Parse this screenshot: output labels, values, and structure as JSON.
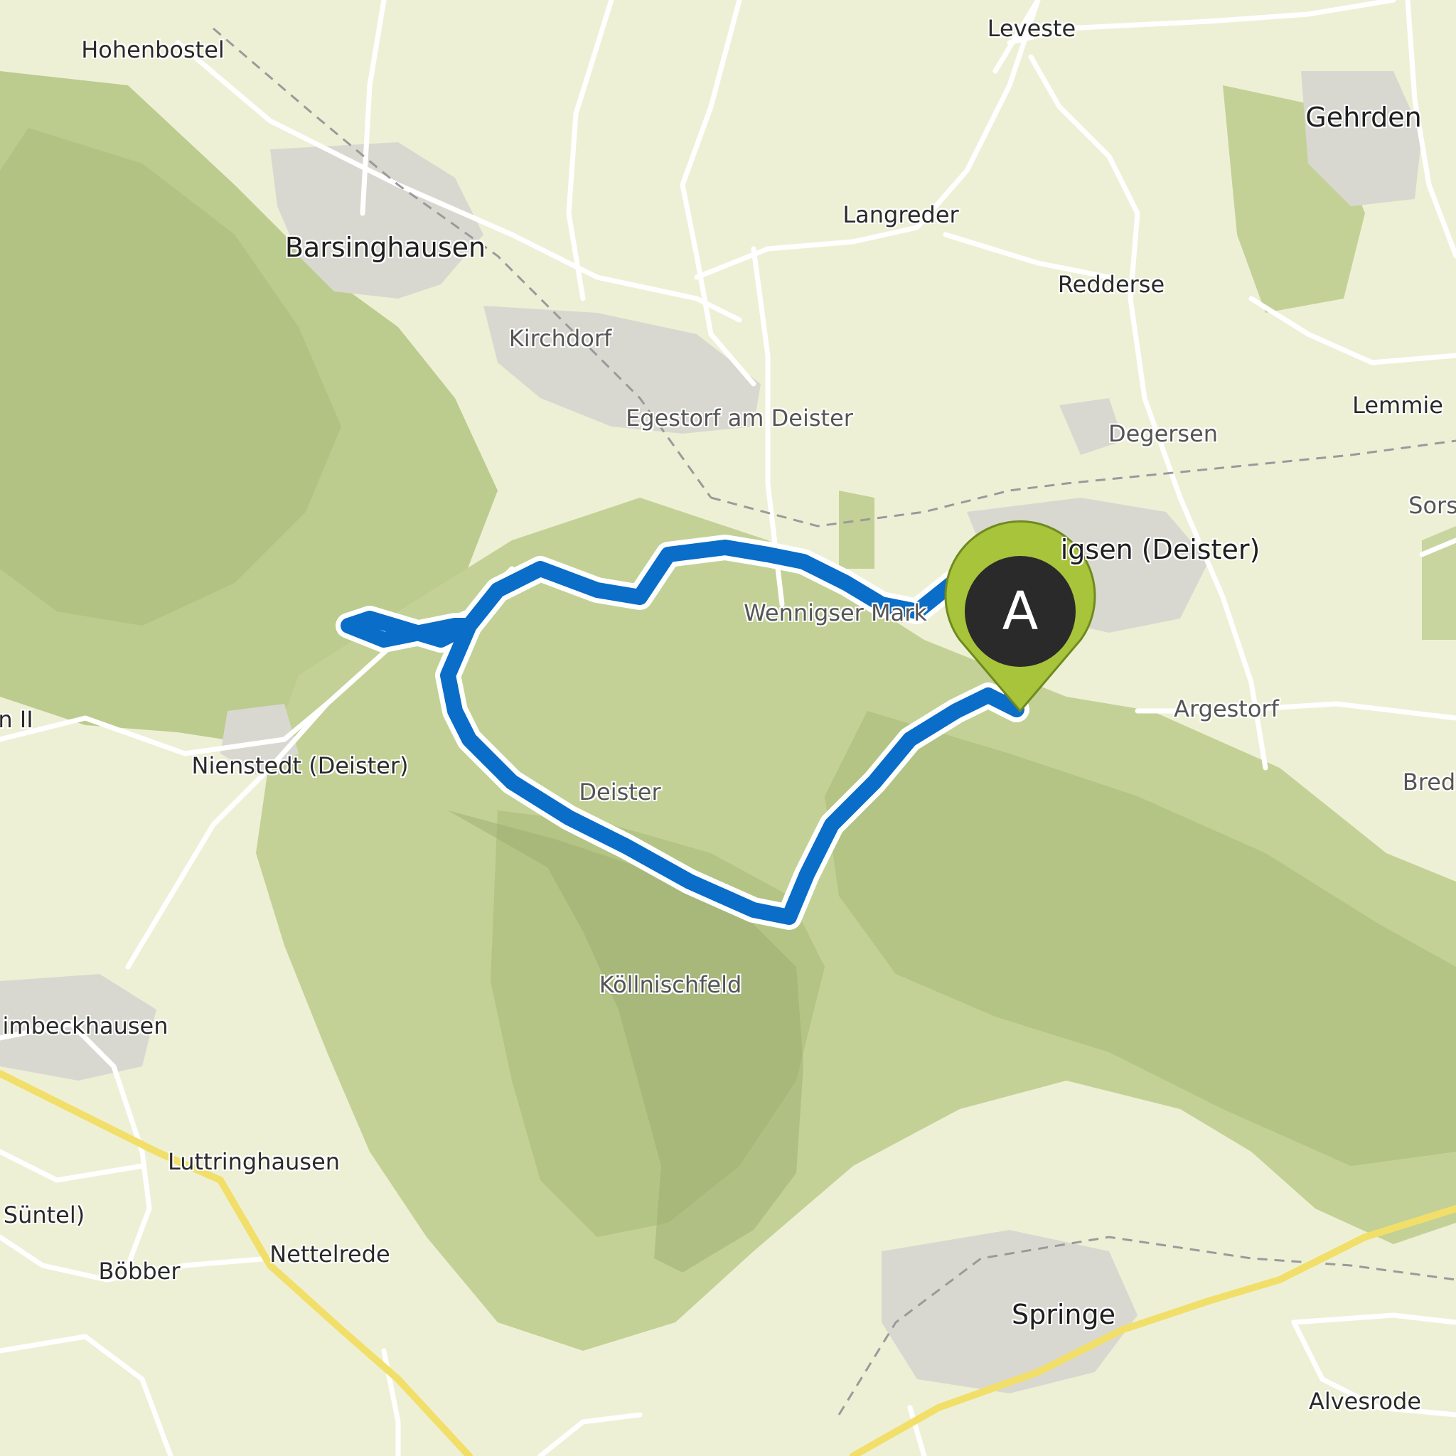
{
  "map": {
    "route_color": "#0a6dc8",
    "marker": {
      "letter": "A",
      "color": "#a8c43a",
      "inner_color": "#2a2a2a"
    },
    "places": {
      "hohenbostel": "Hohenbostel",
      "leveste": "Leveste",
      "gehrden": "Gehrden",
      "barsinghausen": "Barsinghausen",
      "langreder": "Langreder",
      "redderse": "Redderse",
      "kirchdorf": "Kirchdorf",
      "egestorf": "Egestorf am Deister",
      "lemmie": "Lemmie",
      "degersen": "Degersen",
      "sorsum": "Sors",
      "wennigsen": "igsen (Deister)",
      "wennigser_mark": "Wennigser Mark",
      "argestorf": "Argestorf",
      "bredenbeck": "Bred",
      "ii": "n II",
      "nienstedt": "Nienstedt (Deister)",
      "deister": "Deister",
      "koellnischfeld": "Köllnischfeld",
      "beckhausen": "imbeckhausen",
      "luttringhausen": "Luttringhausen",
      "suentel": "Süntel)",
      "nettelrede": "Nettelrede",
      "boebber": "Böbber",
      "springe": "Springe",
      "alvesrode": "Alvesrode"
    }
  }
}
